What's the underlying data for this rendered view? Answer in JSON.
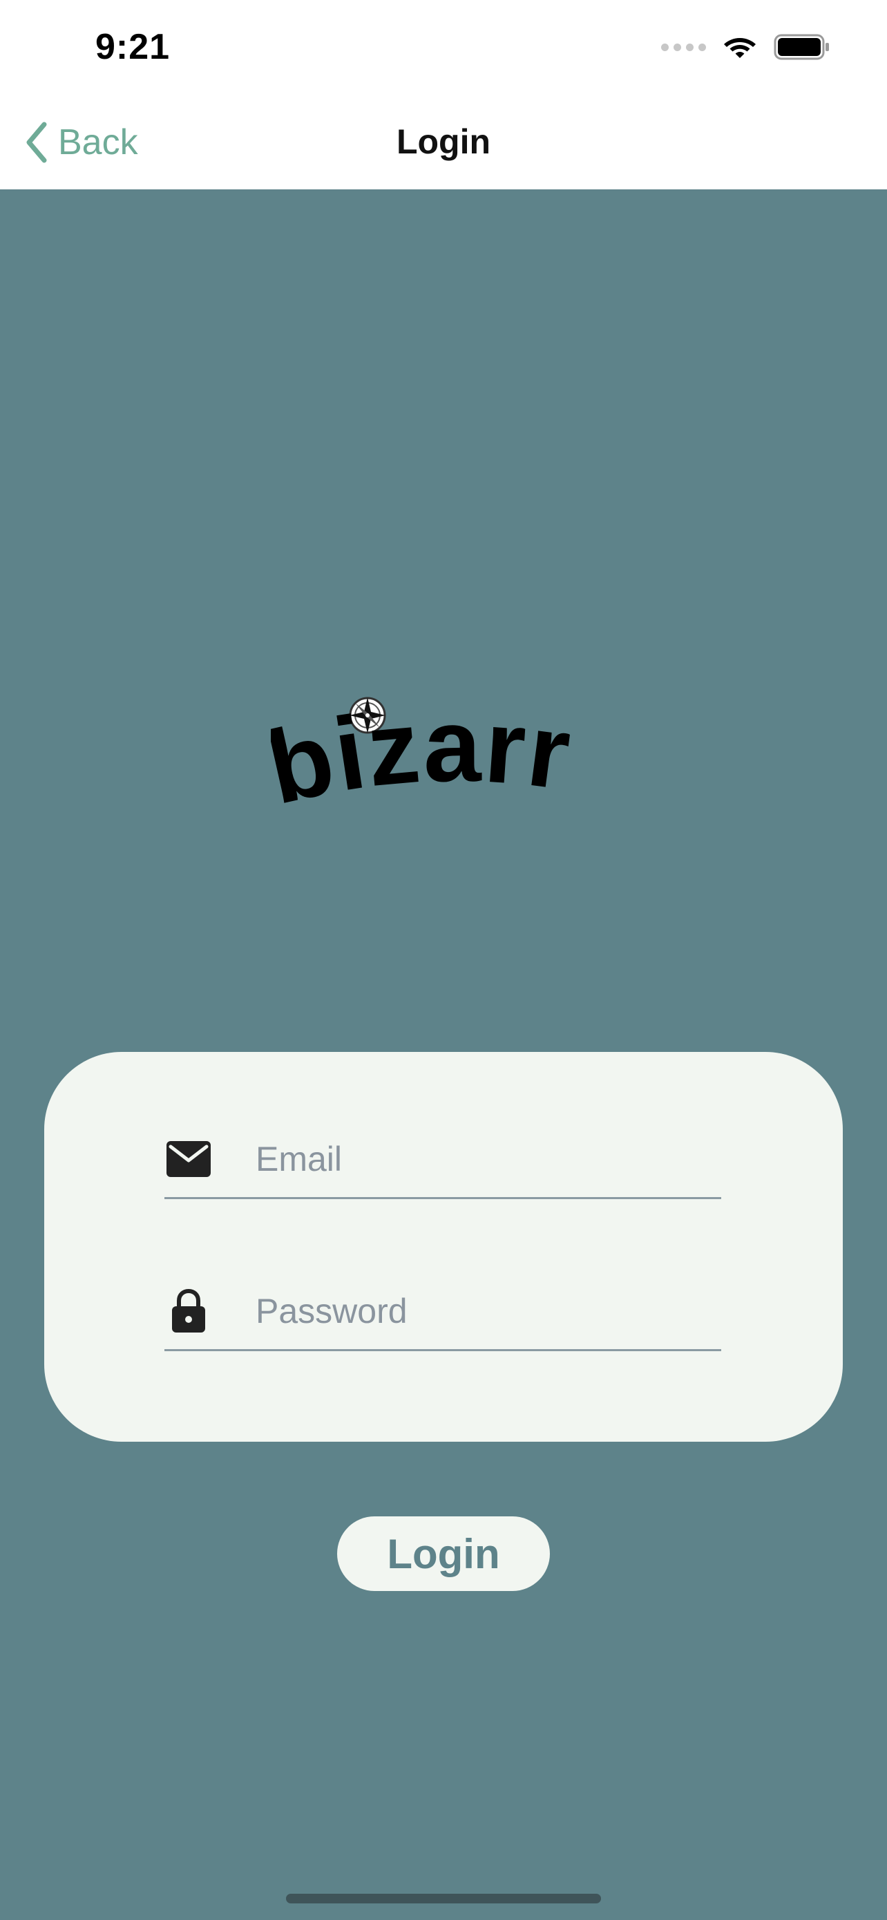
{
  "status_bar": {
    "time": "9:21",
    "icons": [
      "signal-dots-icon",
      "wifi-icon",
      "battery-icon"
    ]
  },
  "nav": {
    "back_label": "Back",
    "title": "Login"
  },
  "logo": {
    "text": "bizarr"
  },
  "form": {
    "email": {
      "placeholder": "Email",
      "value": "",
      "icon": "envelope-icon"
    },
    "password": {
      "placeholder": "Password",
      "value": "",
      "icon": "lock-icon"
    },
    "submit_label": "Login"
  },
  "colors": {
    "background": "#5e838a",
    "card": "#f2f6f1",
    "accent": "#6fab97",
    "button_text": "#5e838a"
  }
}
